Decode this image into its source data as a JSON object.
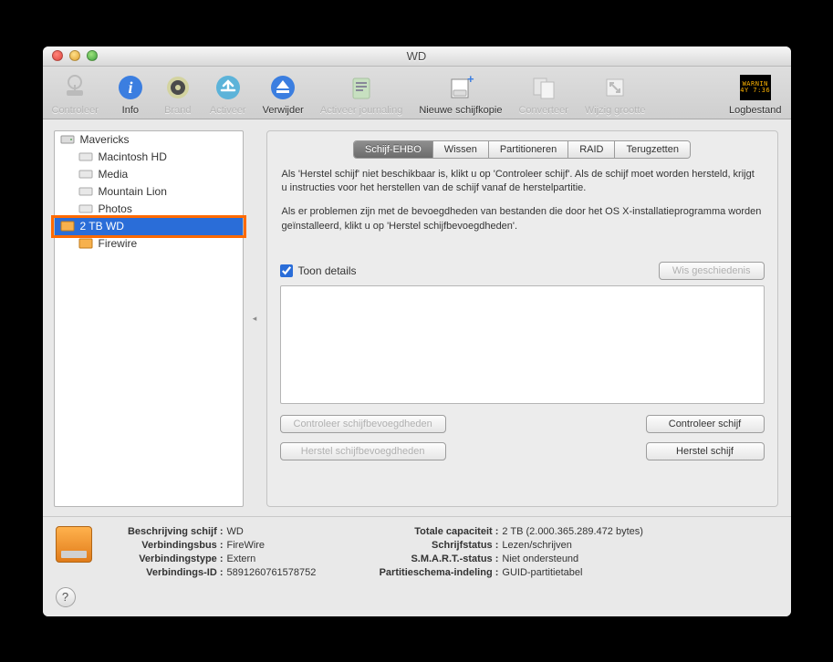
{
  "window": {
    "title": "WD"
  },
  "toolbar": {
    "items": [
      {
        "label": "Controleer",
        "icon": "verify-icon"
      },
      {
        "label": "Info",
        "icon": "info-icon"
      },
      {
        "label": "Brand",
        "icon": "burn-icon"
      },
      {
        "label": "Activeer",
        "icon": "mount-icon"
      },
      {
        "label": "Verwijder",
        "icon": "eject-icon"
      },
      {
        "label": "Activeer journaling",
        "icon": "journal-icon"
      },
      {
        "label": "Nieuwe schijfkopie",
        "icon": "new-image-icon"
      },
      {
        "label": "Converteer",
        "icon": "convert-icon"
      },
      {
        "label": "Wijzig grootte",
        "icon": "resize-icon"
      },
      {
        "label": "Logbestand",
        "icon": "log-icon"
      }
    ]
  },
  "sidebar": {
    "items": [
      {
        "label": "Mavericks",
        "level": 1,
        "kind": "internal-disk"
      },
      {
        "label": "Macintosh HD",
        "level": 2,
        "kind": "volume"
      },
      {
        "label": "Media",
        "level": 2,
        "kind": "volume"
      },
      {
        "label": "Mountain Lion",
        "level": 2,
        "kind": "volume"
      },
      {
        "label": "Photos",
        "level": 2,
        "kind": "volume"
      },
      {
        "label": "2 TB WD",
        "level": 1,
        "kind": "external-disk",
        "selected": true
      },
      {
        "label": "Firewire",
        "level": 2,
        "kind": "external-volume"
      }
    ]
  },
  "tabs": {
    "items": [
      {
        "label": "Schijf-EHBO",
        "active": true
      },
      {
        "label": "Wissen"
      },
      {
        "label": "Partitioneren"
      },
      {
        "label": "RAID"
      },
      {
        "label": "Terugzetten"
      }
    ]
  },
  "help": {
    "p1": "Als 'Herstel schijf' niet beschikbaar is, klikt u op 'Controleer schijf'. Als de schijf moet worden hersteld, krijgt u instructies voor het herstellen van de schijf vanaf de herstelpartitie.",
    "p2": "Als er problemen zijn met de bevoegdheden van bestanden die door het OS X-installatieprogramma worden geïnstalleerd, klikt u op 'Herstel schijfbevoegdheden'."
  },
  "controls": {
    "show_details": "Toon details",
    "clear_history": "Wis geschiedenis",
    "verify_permissions": "Controleer schijfbevoegdheden",
    "repair_permissions": "Herstel schijfbevoegdheden",
    "verify_disk": "Controleer schijf",
    "repair_disk": "Herstel schijf"
  },
  "footer": {
    "left": [
      {
        "k": "Beschrijving schijf :",
        "v": "WD"
      },
      {
        "k": "Verbindingsbus :",
        "v": "FireWire"
      },
      {
        "k": "Verbindingstype :",
        "v": "Extern"
      },
      {
        "k": "Verbindings-ID :",
        "v": "5891260761578752"
      }
    ],
    "right": [
      {
        "k": "Totale capaciteit :",
        "v": "2 TB (2.000.365.289.472 bytes)"
      },
      {
        "k": "Schrijfstatus :",
        "v": "Lezen/schrijven"
      },
      {
        "k": "S.M.A.R.T.-status :",
        "v": "Niet ondersteund"
      },
      {
        "k": "Partitieschema-indeling :",
        "v": "GUID-partitietabel"
      }
    ]
  },
  "warnbox": {
    "line1": "WARNIN",
    "line2": "4Y 7:36"
  }
}
